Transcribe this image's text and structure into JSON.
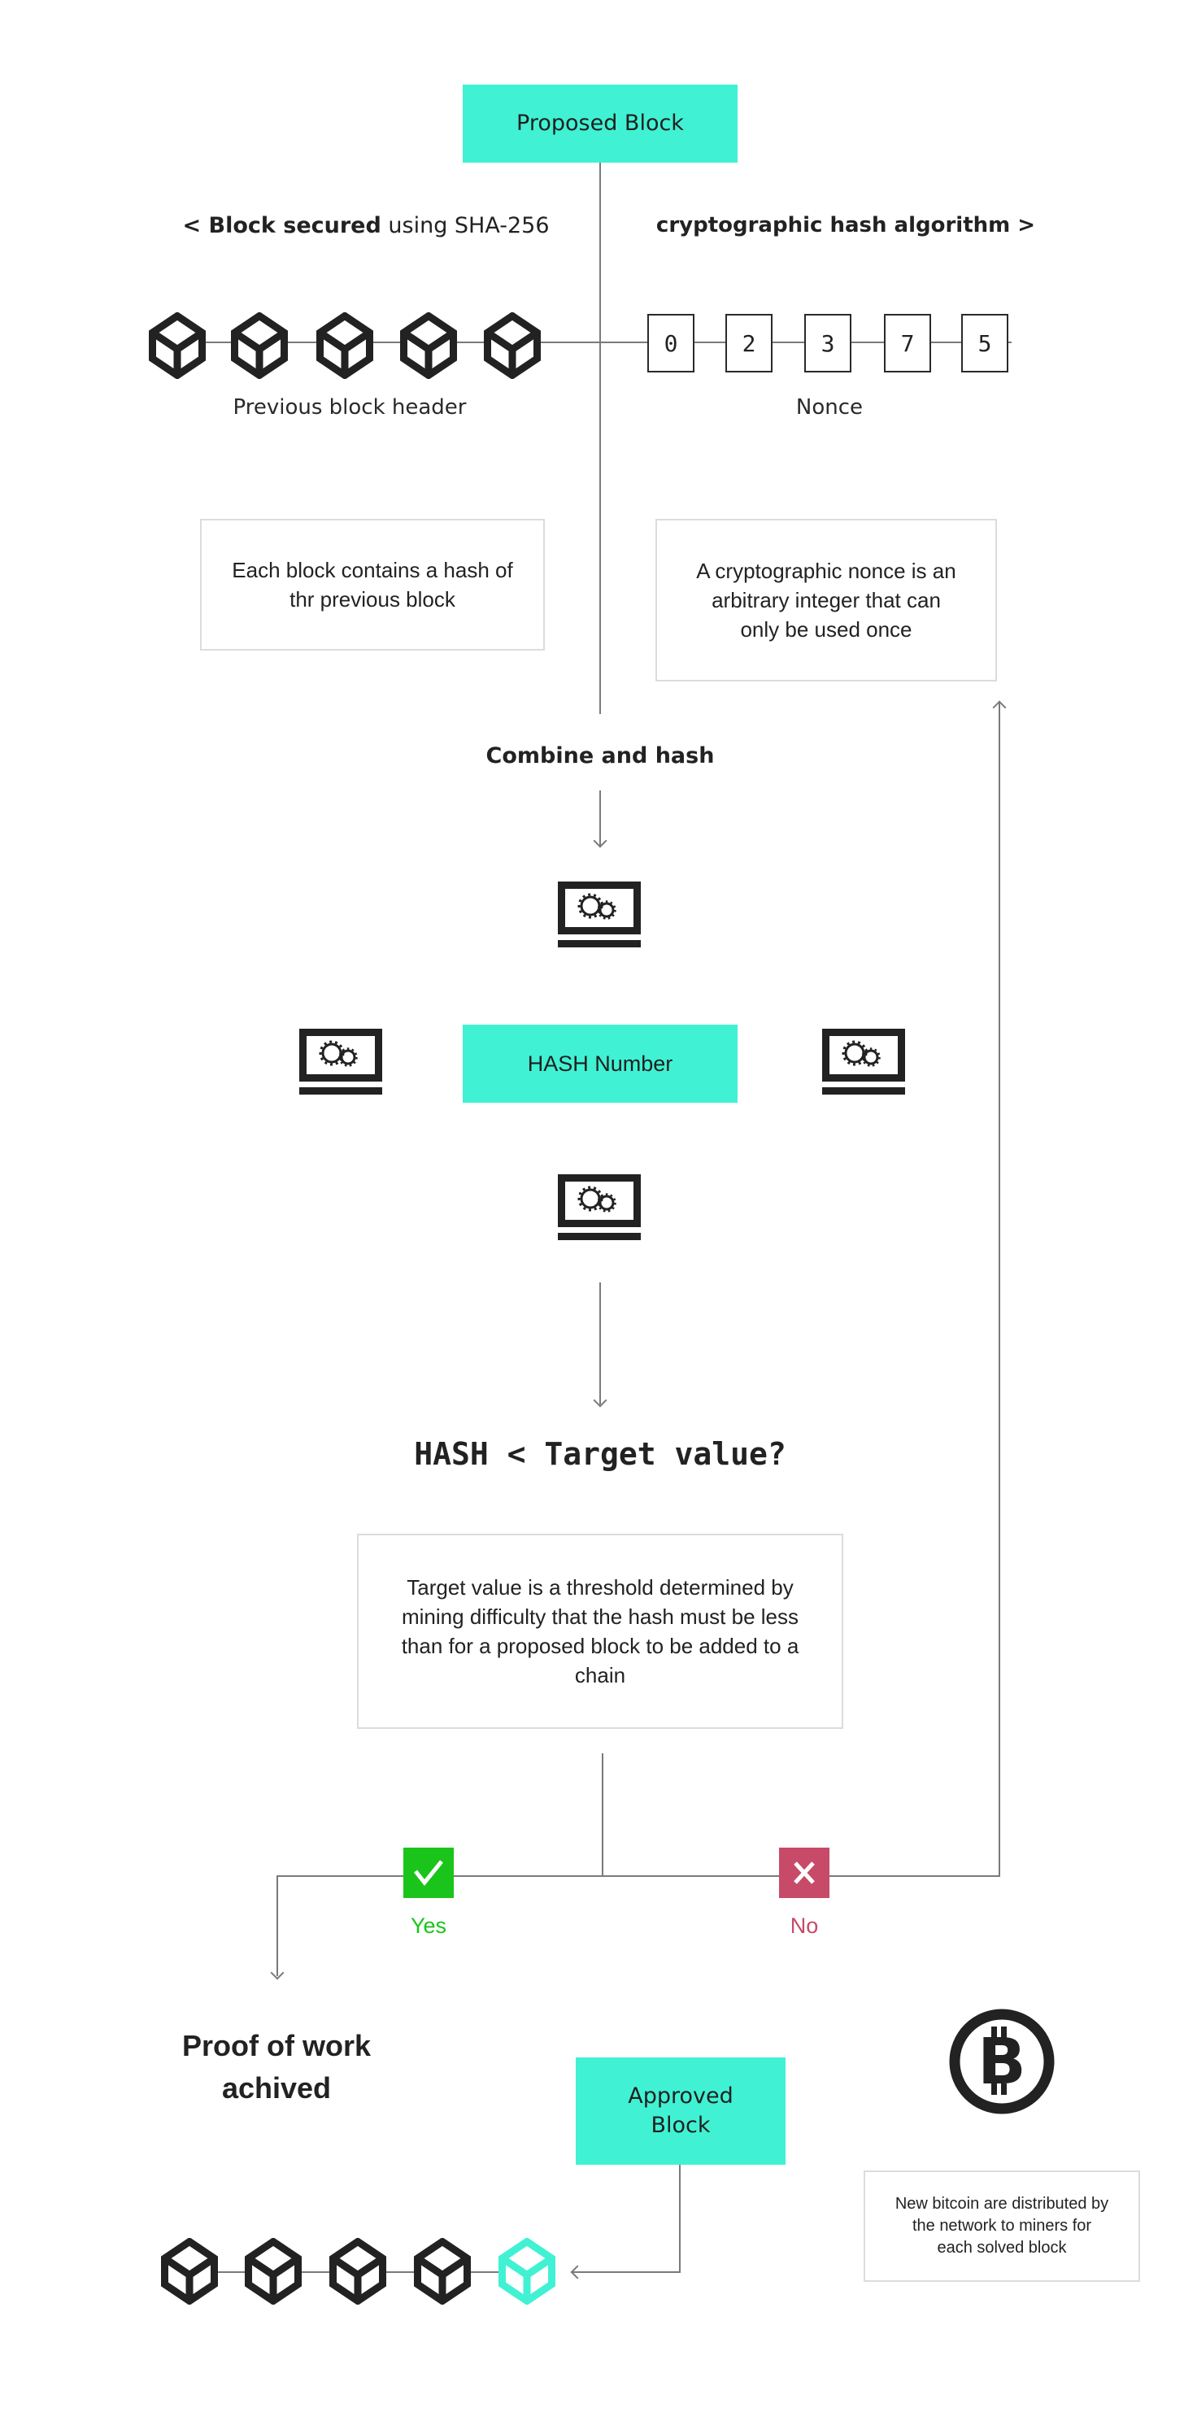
{
  "colors": {
    "accent": "#40f2d3",
    "ink": "#222222",
    "connector": "#7a7a7a",
    "note_border": "#dcdcdc",
    "yes": "#1bc41b",
    "no": "#c74a68"
  },
  "proposed_block": {
    "label": "Proposed Block"
  },
  "header_left": {
    "prefix": "< ",
    "bold": "Block secured",
    "rest": " using SHA-256"
  },
  "header_right": {
    "bold": "cryptographic hash algorithm >"
  },
  "previous_chain": {
    "icon": "cube-icon",
    "count": 5,
    "caption": "Previous block header"
  },
  "nonce": {
    "digits": [
      "0",
      "2",
      "3",
      "7",
      "5"
    ],
    "caption": "Nonce"
  },
  "notes": {
    "previous_hash": "Each block contains a hash of thr previous block",
    "nonce_def": "A cryptographic nonce is an arbitrary integer that can only be used once",
    "target_def": "Target value is a threshold determined by mining difficulty that the hash must be less than for a proposed block to be added to a chain",
    "reward": "New bitcoin are distributed by the network to miners for each solved block"
  },
  "combine_label": "Combine and hash",
  "hash_number": {
    "label": "HASH Number",
    "miner_icon": "computer-gears-icon"
  },
  "question": "HASH < Target value?",
  "decision": {
    "yes": {
      "label": "Yes",
      "icon": "checkmark-icon"
    },
    "no": {
      "label": "No",
      "icon": "x-icon"
    }
  },
  "proof_of_work": "Proof of work achived",
  "approved_block": {
    "label": "Approved Block"
  },
  "reward_icon": "bitcoin-icon",
  "final_chain": {
    "icon": "cube-icon",
    "count": 5,
    "highlighted_index": 4
  }
}
